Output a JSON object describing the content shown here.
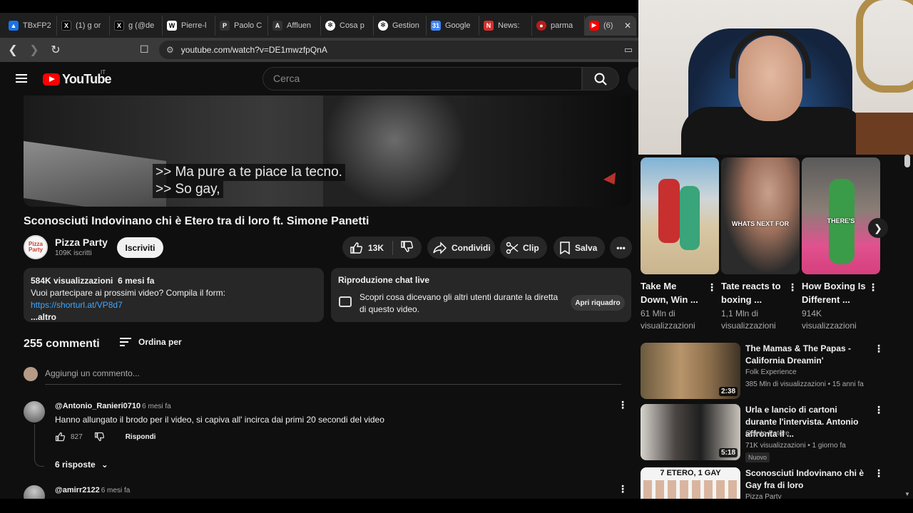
{
  "browser": {
    "tabs": [
      {
        "label": "TBxFP2",
        "color": "#1a73e8",
        "icon": "drive-icon"
      },
      {
        "label": "(1) g or",
        "color": "#000000",
        "icon": "x-icon"
      },
      {
        "label": "g (@de",
        "color": "#000000",
        "icon": "x-icon"
      },
      {
        "label": "Pierre-l",
        "color": "#ffffff",
        "icon": "wikipedia-icon"
      },
      {
        "label": "Paolo C",
        "color": "#333333",
        "icon": "site-icon"
      },
      {
        "label": "Affluen",
        "color": "#333333",
        "icon": "site-icon"
      },
      {
        "label": "Cosa p",
        "color": "#ffffff",
        "icon": "chatgpt-icon"
      },
      {
        "label": "Gestion",
        "color": "#ffffff",
        "icon": "chatgpt-icon"
      },
      {
        "label": "Google",
        "color": "#4285f4",
        "icon": "calendar-icon"
      },
      {
        "label": "News:",
        "color": "#d32f2f",
        "icon": "news-icon"
      },
      {
        "label": "parma",
        "color": "#b71c1c",
        "icon": "shield-icon"
      },
      {
        "label": "(6)",
        "color": "#ff0000",
        "icon": "youtube-icon"
      }
    ],
    "url": "youtube.com/watch?v=DE1mwzfpQnA"
  },
  "youtube": {
    "logo_text": "YouTube",
    "country": "IT",
    "search_placeholder": "Cerca"
  },
  "video": {
    "caption_line1": ">> Ma pure a te piace la tecno.",
    "caption_line2": ">> So gay,",
    "title": "Sconosciuti Indovinano chi è Etero tra di loro ft. Simone Panetti"
  },
  "channel": {
    "avatar_text": "Pizza Party",
    "name": "Pizza Party",
    "subs": "109K iscritti",
    "subscribe_label": "Iscriviti"
  },
  "actions": {
    "likes": "13K",
    "share": "Condividi",
    "clip": "Clip",
    "save": "Salva"
  },
  "description": {
    "views": "584K visualizzazioni",
    "age": "6 mesi fa",
    "text": "Vuoi partecipare ai prossimi video? Compila il form:",
    "link": "https://shorturl.at/VP8d7",
    "more": "...altro"
  },
  "chat": {
    "title": "Riproduzione chat live",
    "text": "Scopri cosa dicevano gli altri utenti durante la diretta di questo video.",
    "open": "Apri riquadro"
  },
  "comments": {
    "count": "255 commenti",
    "sort": "Ordina per",
    "add_placeholder": "Aggiungi un commento...",
    "items": [
      {
        "user": "@Antonio_Ranieri0710",
        "time": "6 mesi fa",
        "text": "Hanno allungato il brodo per il video, si capiva all' incirca dai primi 20 secondi del video",
        "likes": "827",
        "reply": "Rispondi",
        "replies": "6 risposte"
      },
      {
        "user": "@amirr2122",
        "time": "6 mesi fa"
      }
    ]
  },
  "shorts": [
    {
      "title": "Take Me Down, Win ...",
      "views": "61 Mln di visualizzazioni",
      "overlay": ""
    },
    {
      "title": "Tate reacts to boxing ...",
      "views": "1,1 Mln di visualizzazioni",
      "overlay": "WHATS NEXT FOR"
    },
    {
      "title": "How Boxing Is Different ...",
      "views": "914K visualizzazioni",
      "overlay": "THERE'S"
    }
  ],
  "related": [
    {
      "title": "The Mamas & The Papas - California Dreamin'",
      "channel": "Folk Experience",
      "meta": "385 Mln di visualizzazioni • 15 anni fa",
      "duration": "2:38"
    },
    {
      "title": "Urla e lancio di cartoni durante l'intervista. Antonio affronta il ...",
      "channel": "Quinto Potere",
      "meta": "71K visualizzazioni • 1 giorno fa",
      "duration": "5:18",
      "badge": "Nuovo"
    },
    {
      "title": "Sconosciuti Indovinano chi è Gay fra di loro",
      "channel": "Pizza Party",
      "thumb_text": "7 ETERO, 1 GAY"
    }
  ]
}
